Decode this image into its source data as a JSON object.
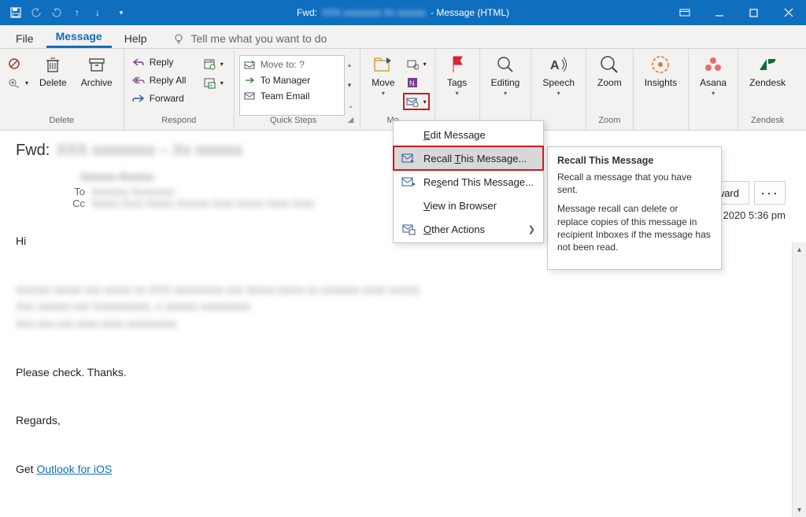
{
  "titlebar": {
    "prefix": "Fwd:",
    "subject_blur": "XXX xxxxxxxx  Xx xxxxxx",
    "suffix": "- Message (HTML)"
  },
  "tabs": {
    "file": "File",
    "message": "Message",
    "help": "Help",
    "tellme": "Tell me what you want to do"
  },
  "ribbon": {
    "delete": {
      "ignore": "",
      "junk": "",
      "delete": "Delete",
      "archive": "Archive",
      "group": "Delete"
    },
    "respond": {
      "reply": "Reply",
      "reply_all": "Reply All",
      "forward": "Forward",
      "meeting": "",
      "more": "",
      "group": "Respond"
    },
    "quicksteps": {
      "moveto": "Move to: ?",
      "tomanager": "To Manager",
      "teamemail": "Team Email",
      "group": "Quick Steps"
    },
    "move": {
      "move": "Move",
      "group": "Move"
    },
    "tags": {
      "label": "Tags",
      "group": ""
    },
    "editing": {
      "label": "Editing"
    },
    "speech": {
      "label": "Speech"
    },
    "zoom": {
      "label": "Zoom",
      "group": "Zoom"
    },
    "insights": {
      "label": "Insights"
    },
    "asana": {
      "label": "Asana"
    },
    "zendesk": {
      "label": "Zendesk",
      "group": "Zendesk"
    }
  },
  "dropdown": {
    "edit": "Edit Message",
    "recall": "Recall This Message...",
    "resend": "Resend This Message...",
    "viewbrowser": "View in Browser",
    "other": "Other Actions"
  },
  "tooltip": {
    "title": "Recall This Message",
    "p1": "Recall a message that you have sent.",
    "p2": "Message recall can delete or replace copies of this message in recipient Inboxes if the message has not been read."
  },
  "message": {
    "subject_label": "Fwd:",
    "subject_blur": "XXX xxxxxxxx – Xx xxxxxx",
    "from_blur": "Xxxxxx Xxxxxx",
    "to_label": "To",
    "to_blur": "Xxxxxxx  Xxxxxxxx",
    "cc_label": "Cc",
    "cc_blur": "Xxxxx Xxxx Xxxxx Xxxxxx  Xxxx Xxxxx Xxxx Xxxx",
    "hi": "Hi",
    "b1": "Xxxxxx xxxxx xxx xxxxx xx XXX  xxxxxxxxx xxx Xxxxx (xxxx xx xxxxxxx xxxx xxxxx)",
    "b2": "Xxx xxxxxx xxx Xxxxxxxxxx,   x xxxxxx xxxxxxxxx",
    "b3": "Xxx xxx xxx xxxx xxxx xxxxxxxxx.",
    "check": "Please check. Thanks.",
    "regards": "Regards,",
    "get": "Get ",
    "outlook_link": "Outlook for iOS",
    "forward_btn": "ward",
    "date": "2020 5:36 pm"
  }
}
